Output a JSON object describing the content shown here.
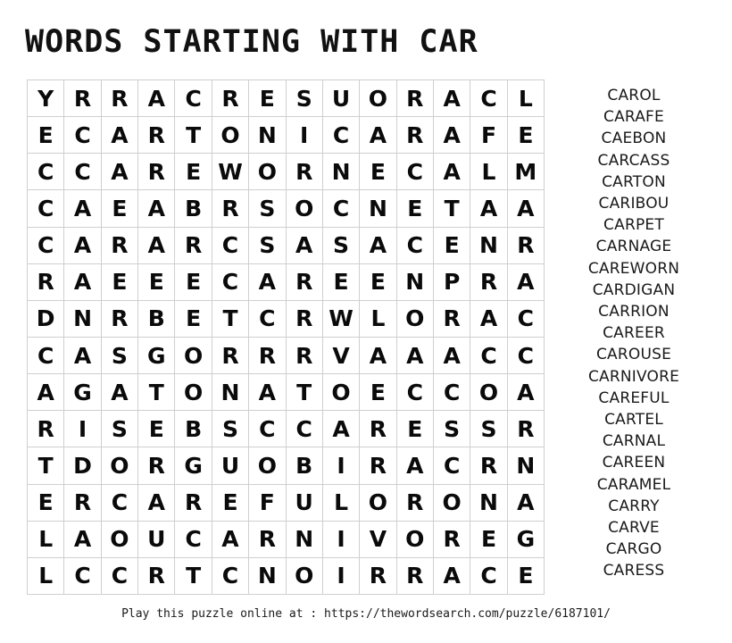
{
  "title": "WORDS STARTING WITH CAR",
  "grid": {
    "rows": 14,
    "cols": 14,
    "border_color": "#cfcfcf",
    "letters": [
      [
        "Y",
        "R",
        "R",
        "A",
        "C",
        "R",
        "E",
        "S",
        "U",
        "O",
        "R",
        "A",
        "C",
        "L"
      ],
      [
        "E",
        "C",
        "A",
        "R",
        "T",
        "O",
        "N",
        "I",
        "C",
        "A",
        "R",
        "A",
        "F",
        "E"
      ],
      [
        "C",
        "C",
        "A",
        "R",
        "E",
        "W",
        "O",
        "R",
        "N",
        "E",
        "C",
        "A",
        "L",
        "M"
      ],
      [
        "C",
        "A",
        "E",
        "A",
        "B",
        "R",
        "S",
        "O",
        "C",
        "N",
        "E",
        "T",
        "A",
        "A"
      ],
      [
        "C",
        "A",
        "R",
        "A",
        "R",
        "C",
        "S",
        "A",
        "S",
        "A",
        "C",
        "E",
        "N",
        "R"
      ],
      [
        "R",
        "A",
        "E",
        "E",
        "E",
        "C",
        "A",
        "R",
        "E",
        "E",
        "N",
        "P",
        "R",
        "A"
      ],
      [
        "D",
        "N",
        "R",
        "B",
        "E",
        "T",
        "C",
        "R",
        "W",
        "L",
        "O",
        "R",
        "A",
        "C"
      ],
      [
        "C",
        "A",
        "S",
        "G",
        "O",
        "R",
        "R",
        "R",
        "V",
        "A",
        "A",
        "A",
        "C",
        "C"
      ],
      [
        "A",
        "G",
        "A",
        "T",
        "O",
        "N",
        "A",
        "T",
        "O",
        "E",
        "C",
        "C",
        "O",
        "A"
      ],
      [
        "R",
        "I",
        "S",
        "E",
        "B",
        "S",
        "C",
        "C",
        "A",
        "R",
        "E",
        "S",
        "S",
        "R"
      ],
      [
        "T",
        "D",
        "O",
        "R",
        "G",
        "U",
        "O",
        "B",
        "I",
        "R",
        "A",
        "C",
        "R",
        "N"
      ],
      [
        "E",
        "R",
        "C",
        "A",
        "R",
        "E",
        "F",
        "U",
        "L",
        "O",
        "R",
        "O",
        "N",
        "A"
      ],
      [
        "L",
        "A",
        "O",
        "U",
        "C",
        "A",
        "R",
        "N",
        "I",
        "V",
        "O",
        "R",
        "E",
        "G"
      ],
      [
        "L",
        "C",
        "C",
        "R",
        "T",
        "C",
        "N",
        "O",
        "I",
        "R",
        "R",
        "A",
        "C",
        "E"
      ]
    ]
  },
  "word_list": [
    "CAROL",
    "CARAFE",
    "CAEBON",
    "CARCASS",
    "CARTON",
    "CARIBOU",
    "CARPET",
    "CARNAGE",
    "CAREWORN",
    "CARDIGAN",
    "CARRION",
    "CAREER",
    "CAROUSE",
    "CARNIVORE",
    "CAREFUL",
    "CARTEL",
    "CARNAL",
    "CAREEN",
    "CARAMEL",
    "CARRY",
    "CARVE",
    "CARGO",
    "CARESS"
  ],
  "footer": "Play this puzzle online at : https://thewordsearch.com/puzzle/6187101/"
}
